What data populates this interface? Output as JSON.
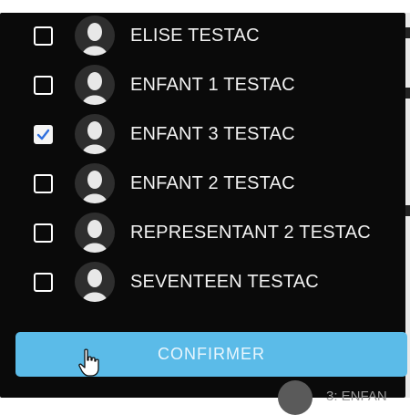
{
  "members": [
    {
      "name": "ELISE TESTAC",
      "checked": false
    },
    {
      "name": "ENFANT 1 TESTAC",
      "checked": false
    },
    {
      "name": "ENFANT 3 TESTAC",
      "checked": true
    },
    {
      "name": "ENFANT 2 TESTAC",
      "checked": false
    },
    {
      "name": "REPRESENTANT 2 TESTAC",
      "checked": false
    },
    {
      "name": "SEVENTEEN TESTAC",
      "checked": false
    }
  ],
  "confirm_label": "CONFIRMER",
  "background_item_text": "3: ENFAN",
  "icons": {
    "avatar": "user-avatar-icon",
    "check": "checkmark-icon",
    "cursor": "hand-pointer-icon"
  },
  "colors": {
    "panel": "#0a0a0a",
    "accent": "#5bbbe8",
    "checkmark": "#2f6fde",
    "text": "#f2f2f2"
  }
}
